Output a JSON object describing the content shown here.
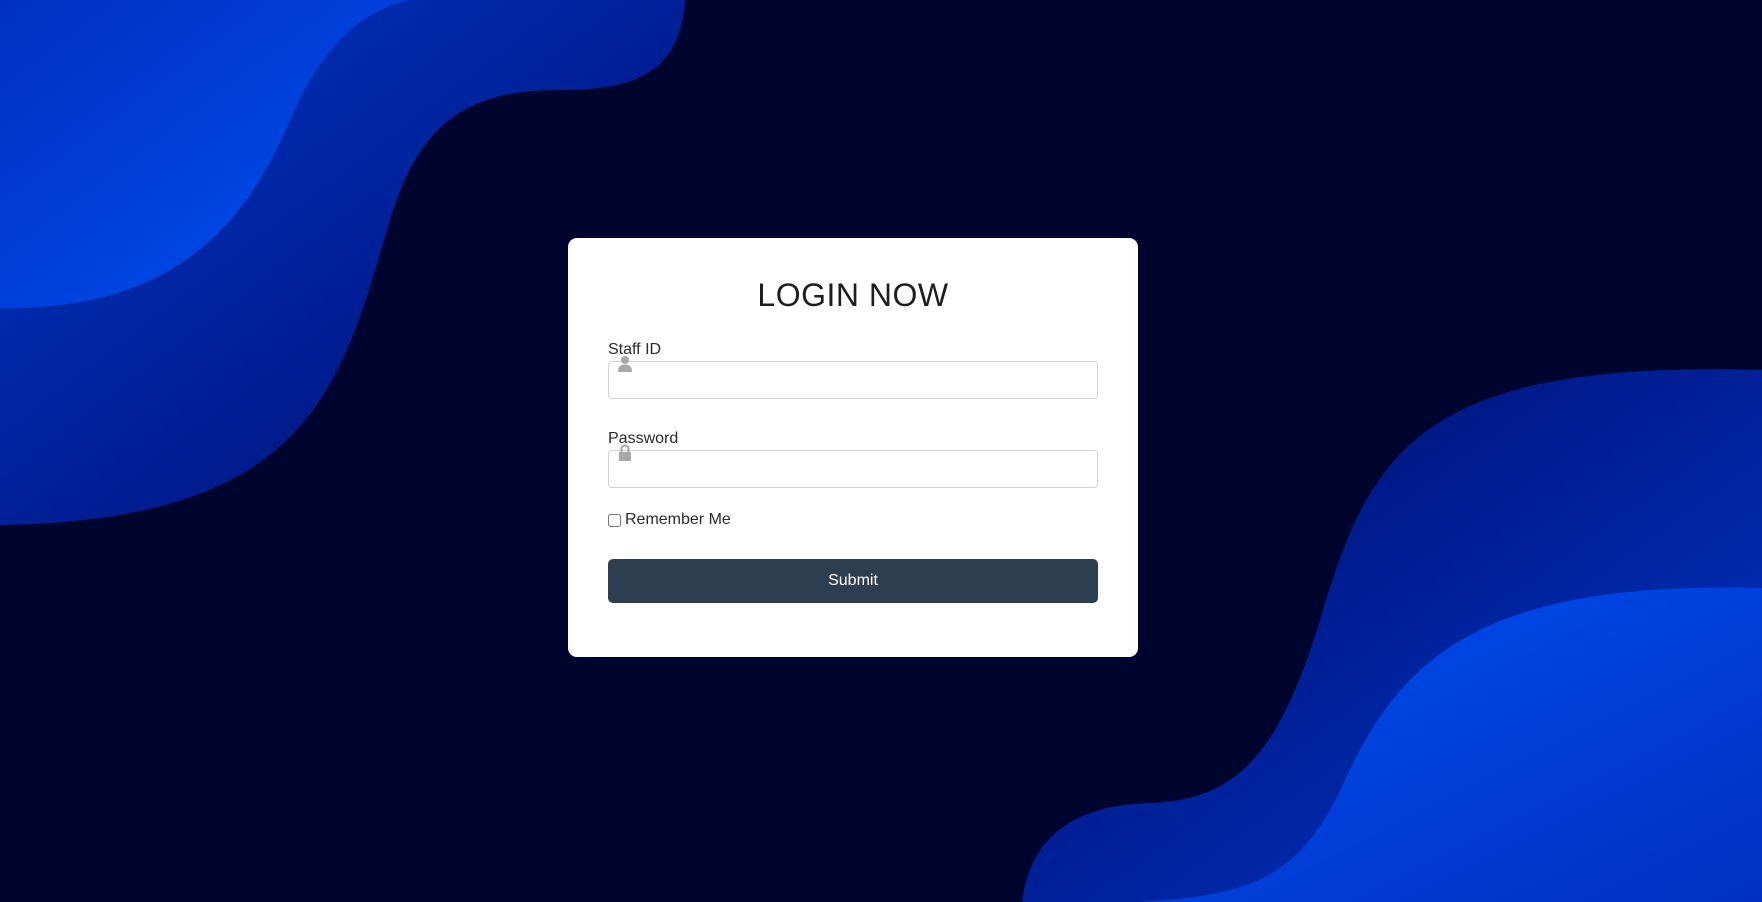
{
  "login": {
    "title": "LOGIN NOW",
    "staff_id": {
      "label": "Staff ID",
      "value": "",
      "icon": "user-icon"
    },
    "password": {
      "label": "Password",
      "value": "",
      "icon": "lock-icon"
    },
    "remember_me": {
      "label": "Remember Me",
      "checked": false
    },
    "submit_label": "Submit"
  },
  "colors": {
    "background": "#00052e",
    "wave_bright": "#0047ee",
    "wave_dark": "#001a8c",
    "card": "#ffffff",
    "button": "#2d3e50",
    "icon": "#a8a8a8"
  }
}
